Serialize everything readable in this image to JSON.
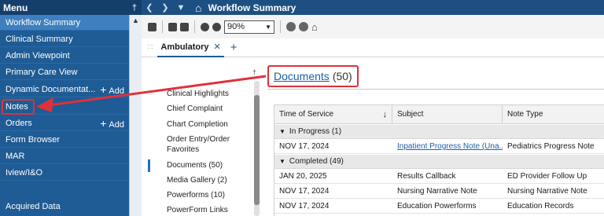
{
  "sidebar": {
    "header": "Menu",
    "items": [
      {
        "label": "Workflow Summary",
        "add": ""
      },
      {
        "label": "Clinical Summary",
        "add": ""
      },
      {
        "label": "Admin Viewpoint",
        "add": ""
      },
      {
        "label": "Primary Care View",
        "add": ""
      },
      {
        "label": "Dynamic Documentat...",
        "add": "Add"
      },
      {
        "label": "Notes",
        "add": ""
      },
      {
        "label": "Orders",
        "add": "Add"
      },
      {
        "label": "Form Browser",
        "add": ""
      },
      {
        "label": "MAR",
        "add": ""
      },
      {
        "label": "Iview/I&O",
        "add": ""
      },
      {
        "label": "Acquired Data",
        "add": ""
      }
    ]
  },
  "topbar": {
    "title": "Workflow Summary"
  },
  "toolbar": {
    "zoom": "90%"
  },
  "tabs": [
    {
      "label": "Ambulatory"
    }
  ],
  "navpanel": {
    "items": [
      "Clinical Highlights",
      "Chief Complaint",
      "Chart Completion",
      "Order Entry/Order",
      "Favorites",
      "Documents (50)",
      "Media Gallery (2)",
      "Powerforms (10)",
      "PowerForm Links"
    ]
  },
  "documents": {
    "title": "Documents",
    "count": "(50)",
    "columns": [
      "Time of Service",
      "Subject",
      "Note Type"
    ],
    "groups": [
      {
        "label": "In Progress (1)",
        "rows": [
          {
            "time": "NOV 17, 2024",
            "subject": "Inpatient Progress Note (Una...",
            "type": "Pediatrics Progress Note",
            "link": true
          }
        ]
      },
      {
        "label": "Completed (49)",
        "rows": [
          {
            "time": "JAN 20, 2025",
            "subject": "Results Callback",
            "type": "ED Provider Follow Up",
            "link": false
          },
          {
            "time": "NOV 17, 2024",
            "subject": "Nursing Narrative Note",
            "type": "Nursing Narrative Note",
            "link": false
          },
          {
            "time": "NOV 17, 2024",
            "subject": "Education Powerforms",
            "type": "Education Records",
            "link": false
          }
        ]
      }
    ]
  },
  "colors": {
    "sidebar": "#1f5b94",
    "topbar": "#1e4f82",
    "highlight": "#e0313a",
    "link": "#1a5fa8"
  }
}
